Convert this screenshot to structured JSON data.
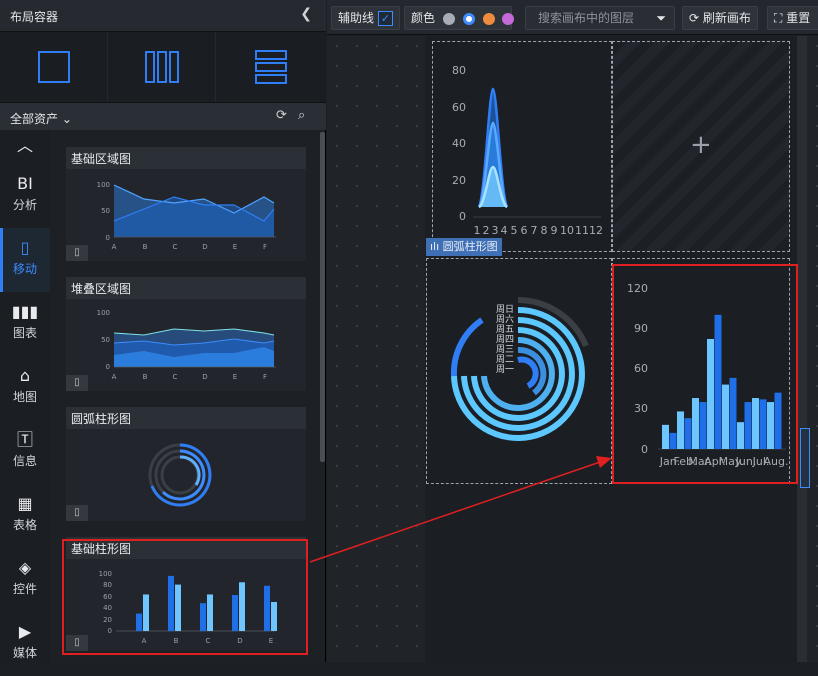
{
  "sidebar": {
    "title": "布局容器",
    "collapse_icon": "chevron-left-icon",
    "asset_filter": "全部资产",
    "categories": [
      {
        "icon": "chevron-up-icon",
        "glyph": "^",
        "label": ""
      },
      {
        "icon": "bi-icon",
        "glyph": "BI",
        "label": "分析"
      },
      {
        "icon": "mobile-icon",
        "glyph": "▯",
        "label": "移动"
      },
      {
        "icon": "bar-chart-icon",
        "glyph": "ılı",
        "label": "图表"
      },
      {
        "icon": "map-icon",
        "glyph": "⌂",
        "label": "地图"
      },
      {
        "icon": "text-icon",
        "glyph": "T",
        "label": "信息"
      },
      {
        "icon": "table-icon",
        "glyph": "▦",
        "label": "表格"
      },
      {
        "icon": "widget-icon",
        "glyph": "◈",
        "label": "控件"
      },
      {
        "icon": "media-icon",
        "glyph": "▶",
        "label": "媒体"
      }
    ],
    "cards": [
      {
        "title": "基础区域图"
      },
      {
        "title": "堆叠区域图"
      },
      {
        "title": "圆弧柱形图"
      },
      {
        "title": "基础柱形图"
      }
    ],
    "thumb_area": {
      "y_ticks": [
        "100",
        "50",
        "0"
      ],
      "x": [
        "A",
        "B",
        "C",
        "D",
        "E",
        "F"
      ]
    },
    "thumb_bar": {
      "y_ticks": [
        "100",
        "80",
        "60",
        "40",
        "20",
        "0"
      ],
      "x": [
        "A",
        "B",
        "C",
        "D",
        "E"
      ],
      "s1": [
        30,
        95,
        48,
        62,
        78
      ],
      "s2": [
        63,
        80,
        63,
        84,
        50
      ]
    }
  },
  "toolbar": {
    "guides_label": "辅助线",
    "color_label": "颜色",
    "colors": [
      "#a7adb6",
      "#3d8bff",
      "#f08a3c",
      "#c46ad8"
    ],
    "search_placeholder": "搜索画布中的图层",
    "refresh_label": "刷新画布",
    "reset_label": "重置"
  },
  "canvas": {
    "add_icon": "plus-icon",
    "radial_tag": "圆弧柱形图",
    "radial_labels": [
      "周日",
      "周六",
      "周五",
      "周四",
      "周三",
      "周二",
      "周一"
    ],
    "area_chart": {
      "y_ticks": [
        "80",
        "60",
        "40",
        "20",
        "0"
      ],
      "x_labels": [
        "1",
        "2",
        "3",
        "4",
        "5",
        "6",
        "7",
        "8",
        "9",
        "10",
        "11",
        "12"
      ]
    },
    "bar_chart": {
      "y_ticks": [
        "120",
        "90",
        "60",
        "30",
        "0"
      ],
      "x_labels": [
        "Jan.",
        "Feb.",
        "Mar.",
        "Apr.",
        "May.",
        "Jun.",
        "Jul.",
        "Aug."
      ]
    }
  },
  "chart_data": {
    "type": "bar",
    "categories": [
      "Jan.",
      "Feb.",
      "Mar.",
      "Apr.",
      "May.",
      "Jun.",
      "Jul.",
      "Aug."
    ],
    "series": [
      {
        "values": [
          18,
          28,
          38,
          82,
          48,
          20,
          38,
          35
        ]
      },
      {
        "values": [
          12,
          23,
          35,
          100,
          53,
          35,
          37,
          42
        ]
      }
    ],
    "ylim": [
      0,
      120
    ],
    "colors": [
      "#6ec6ff",
      "#1f6fe8"
    ]
  }
}
